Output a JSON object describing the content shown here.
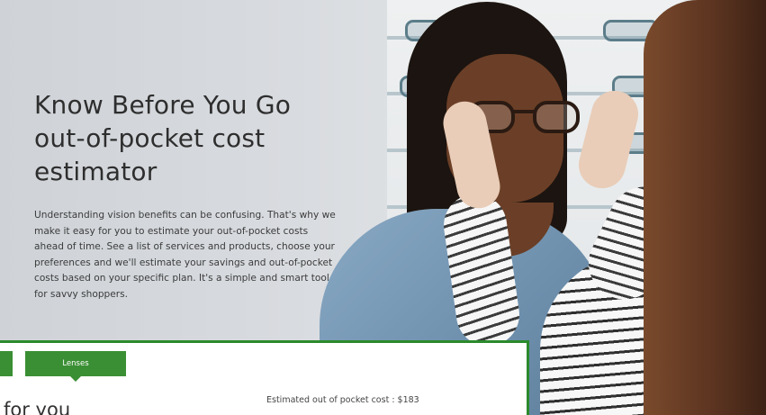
{
  "hero": {
    "title_line1": "Know Before You Go",
    "title_line2": "out-of-pocket cost",
    "title_line3": "estimator",
    "description": "Understanding vision benefits can be confusing. That's why we make it easy for you to estimate your out-of-pocket costs ahead of time. See a list of services and products, choose your preferences and we'll estimate your savings and out-of-pocket costs based on your specific plan. It's a simple and smart tool for savvy shoppers."
  },
  "card": {
    "tab_label": "Lenses",
    "heading_partial": "for you",
    "estimate_label": "Estimated out of pocket cost : $183"
  },
  "colors": {
    "accent_green": "#3a8f34",
    "border_green": "#2b8a2b"
  }
}
